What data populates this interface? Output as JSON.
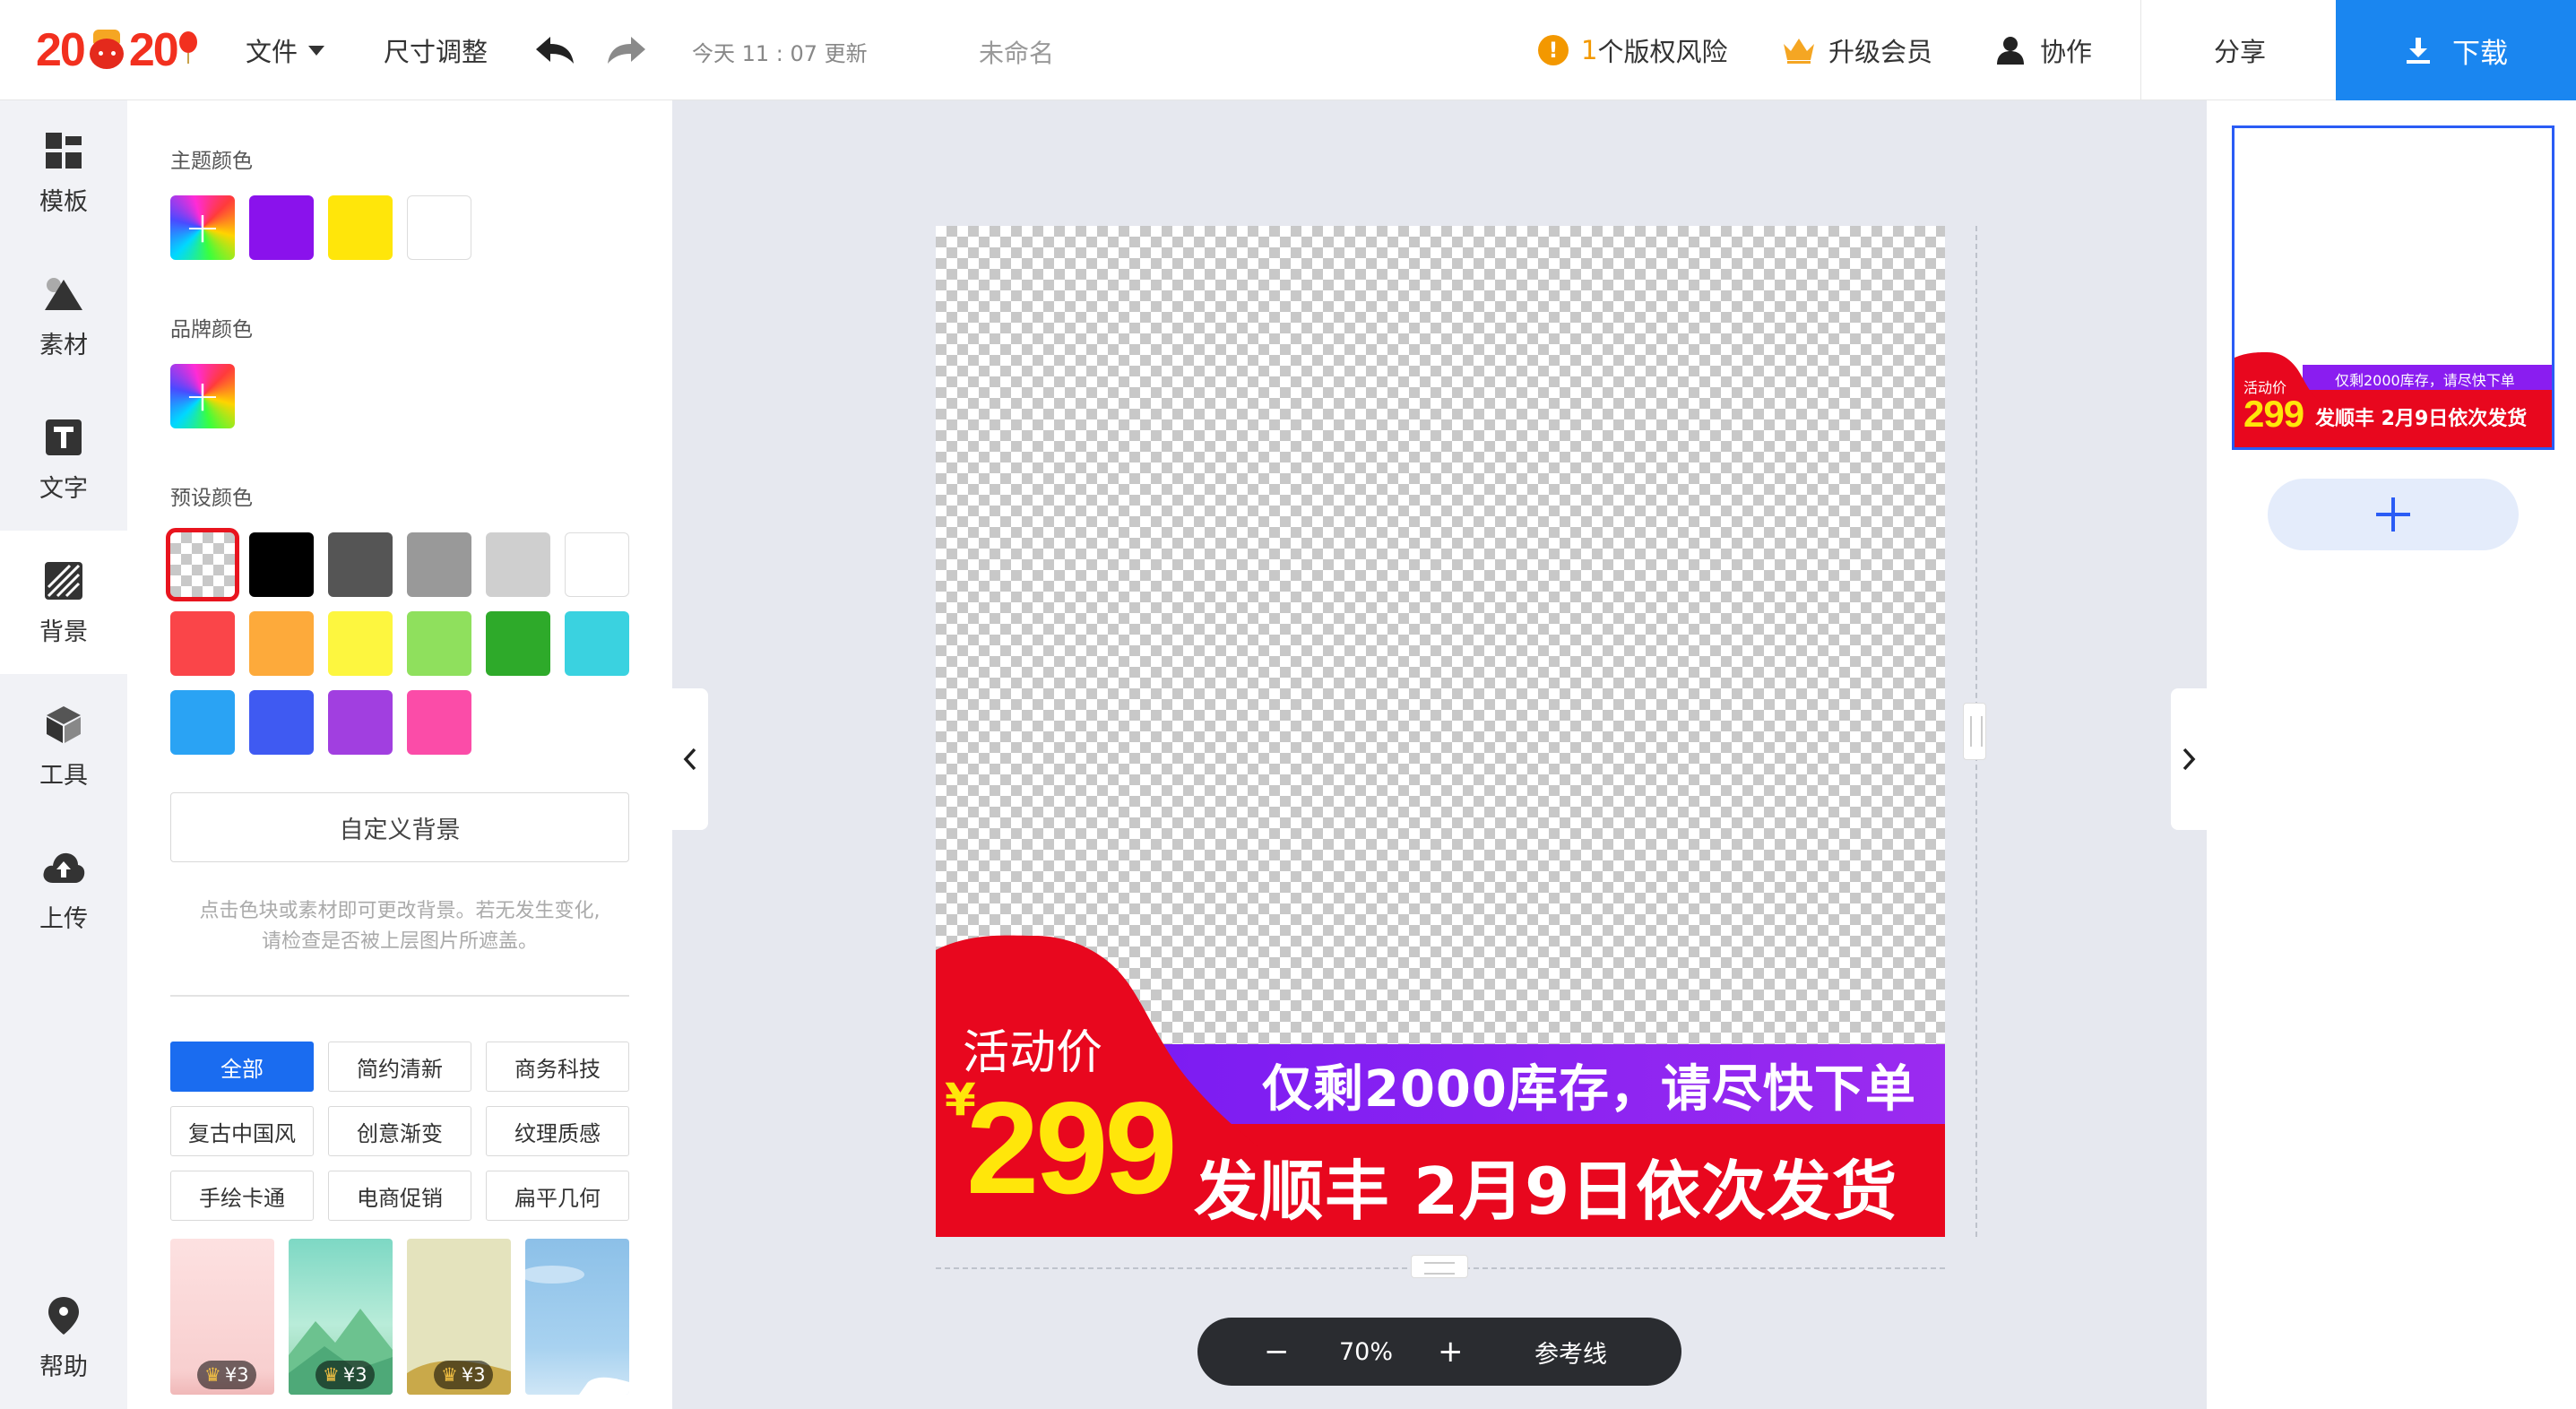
{
  "app": {
    "logo_text": "2020",
    "brand_colors": {
      "primary": "#1a86f0",
      "accent": "#e8141e",
      "warning": "#f39800"
    }
  },
  "topbar": {
    "file_menu": "文件",
    "resize": "尺寸调整",
    "undo_icon": "undo-icon",
    "redo_icon": "redo-icon",
    "updated": "今天 11 : 07 更新",
    "doc_name": "未命名",
    "copyright_count": "1",
    "copyright_text": "个版权风险",
    "upgrade": "升级会员",
    "collab": "协作",
    "share": "分享",
    "download": "下载"
  },
  "leftnav": [
    {
      "label": "模板",
      "icon": "template-grid-icon"
    },
    {
      "label": "素材",
      "icon": "shapes-icon"
    },
    {
      "label": "文字",
      "icon": "text-icon"
    },
    {
      "label": "背景",
      "icon": "background-icon",
      "active": true
    },
    {
      "label": "工具",
      "icon": "cube-icon"
    },
    {
      "label": "上传",
      "icon": "cloud-upload-icon"
    }
  ],
  "help": "帮助",
  "panel": {
    "theme_title": "主题颜色",
    "theme_colors": [
      "#8a12ec",
      "#ffe60a",
      "#ffffff"
    ],
    "brand_title": "品牌颜色",
    "preset_title": "预设颜色",
    "preset_colors": [
      "transparent",
      "#000000",
      "#555555",
      "#999999",
      "#cfcfcf",
      "#ffffff",
      "#fa4549",
      "#fdaa3b",
      "#fdf63f",
      "#8fe05d",
      "#2eaa2a",
      "#3ad2e0",
      "#2aa3f4",
      "#3f5af2",
      "#a13fe0",
      "#fb4ca8"
    ],
    "custom_bg": "自定义背景",
    "hint_line1": "点击色块或素材即可更改背景。若无发生变化,",
    "hint_line2": "请检查是否被上层图片所遮盖。",
    "tags": [
      "全部",
      "简约清新",
      "商务科技",
      "复古中国风",
      "创意渐变",
      "纹理质感",
      "手绘卡通",
      "电商促销",
      "扁平几何"
    ],
    "thumbs": [
      {
        "price": "¥3",
        "style": "pink"
      },
      {
        "price": "¥3",
        "style": "green-mountain"
      },
      {
        "price": "¥3",
        "style": "olive"
      },
      {
        "price": "",
        "style": "sky"
      }
    ]
  },
  "canvas": {
    "activity_label": "活动价",
    "yen": "¥",
    "price": "299",
    "line1": "仅剩2000库存，请尽快下单",
    "line2": "发顺丰 2月9日依次发货"
  },
  "zoom": {
    "minus": "−",
    "value": "70%",
    "plus": "+",
    "guides": "参考线"
  },
  "thumbnail": {
    "activity_label": "活动价",
    "price": "299",
    "line1": "仅剩2000库存，请尽快下单",
    "line2": "发顺丰 2月9日依次发货"
  }
}
